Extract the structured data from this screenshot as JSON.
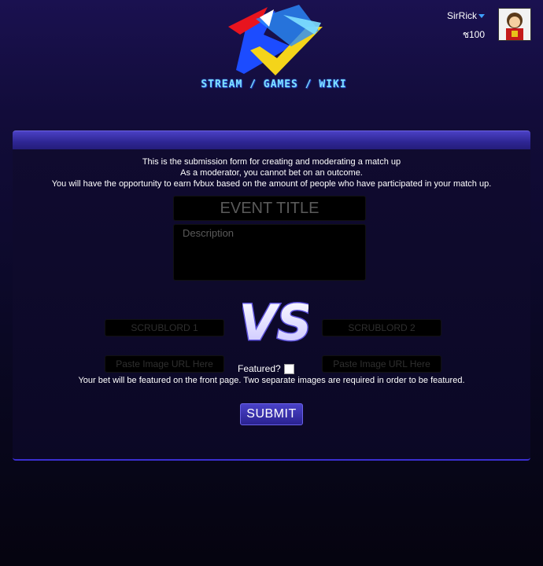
{
  "header": {
    "logo_text": "STREAM / GAMES / WIKI",
    "user": {
      "name": "SirRick",
      "balance": "ช100"
    }
  },
  "form": {
    "intro_lines": [
      "This is the submission form for creating and moderating a match up",
      "As a moderator, you cannot bet on an outcome.",
      "You will have the opportunity to earn fvbux based on the amount of people who have participated in your match up."
    ],
    "event_title_placeholder": "EVENT TITLE",
    "description_placeholder": "Description",
    "player1_placeholder": "SCRUBLORD 1",
    "player2_placeholder": "SCRUBLORD 2",
    "image1_placeholder": "Paste Image URL Here",
    "image2_placeholder": "Paste Image URL Here",
    "vs_label": "VS",
    "featured_label": "Featured?",
    "featured_checked": false,
    "featured_note": "Your bet will be featured on the front page. Two separate images are required in order to be featured.",
    "submit_label": "SUBMIT"
  },
  "colors": {
    "accent": "#3a2fd0",
    "panel_header": "#2e2693",
    "background": "#0a0824"
  }
}
